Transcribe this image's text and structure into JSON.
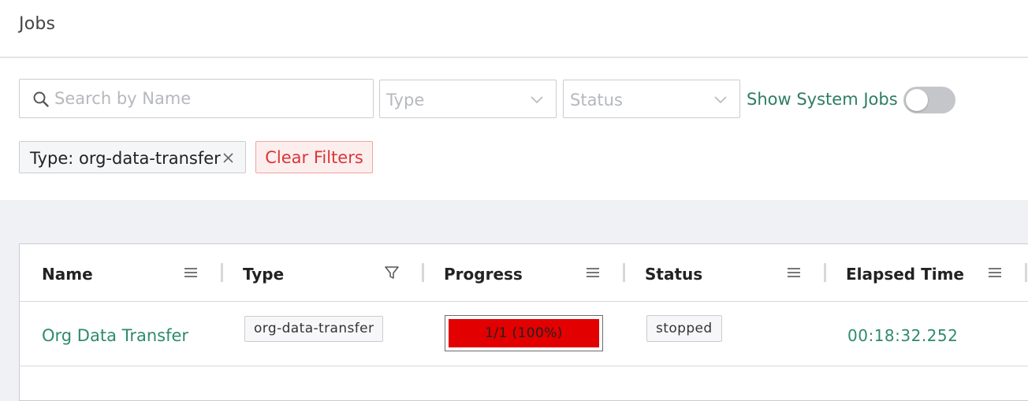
{
  "header": {
    "title": "Jobs"
  },
  "filters": {
    "search_placeholder": "Search by Name",
    "search_value": "",
    "type_select_placeholder": "Type",
    "status_select_placeholder": "Status",
    "show_system_jobs_label": "Show System Jobs",
    "show_system_jobs_on": false,
    "active_filter_chip": "Type: org-data-transfer",
    "clear_filters_label": "Clear Filters"
  },
  "table": {
    "columns": [
      {
        "label": "Name",
        "icon": "menu-icon"
      },
      {
        "label": "Type",
        "icon": "filter-icon"
      },
      {
        "label": "Progress",
        "icon": "menu-icon"
      },
      {
        "label": "Status",
        "icon": "menu-icon"
      },
      {
        "label": "Elapsed Time",
        "icon": "menu-icon"
      }
    ],
    "rows": [
      {
        "name": "Org Data Transfer",
        "type": "org-data-transfer",
        "progress_text": "1/1 (100%)",
        "progress_fraction": 1.0,
        "status": "stopped",
        "elapsed": "00:18:32.252"
      }
    ]
  },
  "colors": {
    "accent_green": "#2e8b6a",
    "progress_fill": "#e20000",
    "clear_filters_red": "#d93636"
  }
}
